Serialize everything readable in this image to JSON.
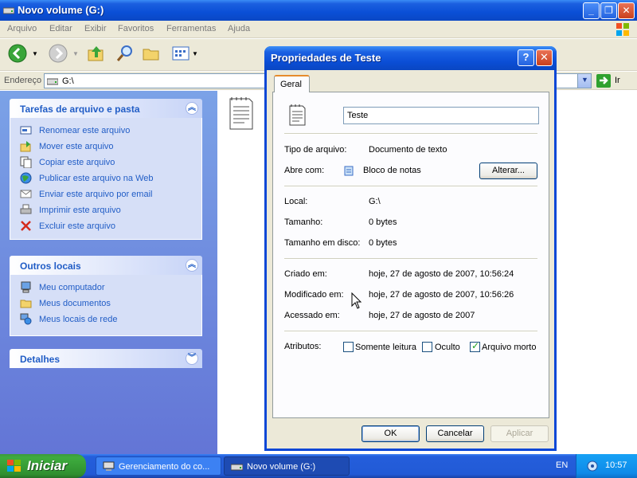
{
  "explorer": {
    "title": "Novo volume (G:)",
    "menu": [
      "Arquivo",
      "Editar",
      "Exibir",
      "Favoritos",
      "Ferramentas",
      "Ajuda"
    ],
    "address_label": "Endereço",
    "address_value": "G:\\",
    "go_label": "Ir"
  },
  "tasks_panel": {
    "title": "Tarefas de arquivo e pasta",
    "items": [
      {
        "label": "Renomear este arquivo",
        "icon": "rename-icon"
      },
      {
        "label": "Mover este arquivo",
        "icon": "move-icon"
      },
      {
        "label": "Copiar este arquivo",
        "icon": "copy-icon"
      },
      {
        "label": "Publicar este arquivo na Web",
        "icon": "globe-icon"
      },
      {
        "label": "Enviar este arquivo por email",
        "icon": "email-icon"
      },
      {
        "label": "Imprimir este arquivo",
        "icon": "printer-icon"
      },
      {
        "label": "Excluir este arquivo",
        "icon": "delete-icon"
      }
    ]
  },
  "places_panel": {
    "title": "Outros locais",
    "items": [
      {
        "label": "Meu computador",
        "icon": "computer-icon"
      },
      {
        "label": "Meus documentos",
        "icon": "documents-folder-icon"
      },
      {
        "label": "Meus locais de rede",
        "icon": "network-icon"
      }
    ]
  },
  "details_panel": {
    "title": "Detalhes"
  },
  "dialog": {
    "title": "Propriedades de Teste",
    "tab": "Geral",
    "file_name": "Teste",
    "type_label": "Tipo de arquivo:",
    "type_value": "Documento de texto",
    "opens_label": "Abre com:",
    "opens_value": "Bloco de notas",
    "change_button": "Alterar...",
    "location_label": "Local:",
    "location_value": "G:\\",
    "size_label": "Tamanho:",
    "size_value": "0 bytes",
    "disk_size_label": "Tamanho em disco:",
    "disk_size_value": "0 bytes",
    "created_label": "Criado em:",
    "created_value": "hoje, 27 de agosto de 2007, 10:56:24",
    "modified_label": "Modificado em:",
    "modified_value": "hoje, 27 de agosto de 2007, 10:56:26",
    "accessed_label": "Acessado em:",
    "accessed_value": "hoje, 27 de agosto de 2007",
    "attributes_label": "Atributos:",
    "readonly_label": "Somente leitura",
    "readonly_checked": false,
    "hidden_label": "Oculto",
    "hidden_checked": false,
    "archive_label": "Arquivo morto",
    "archive_checked": true,
    "ok": "OK",
    "cancel": "Cancelar",
    "apply": "Aplicar"
  },
  "taskbar": {
    "start": "Iniciar",
    "buttons": [
      {
        "label": "Gerenciamento do co...",
        "active": false
      },
      {
        "label": "Novo volume (G:)",
        "active": true
      }
    ],
    "language": "EN",
    "clock": "10:57"
  },
  "colors": {
    "xp_blue": "#0a4fd6",
    "task_link": "#215dc6",
    "start_green": "#3eac3e"
  }
}
